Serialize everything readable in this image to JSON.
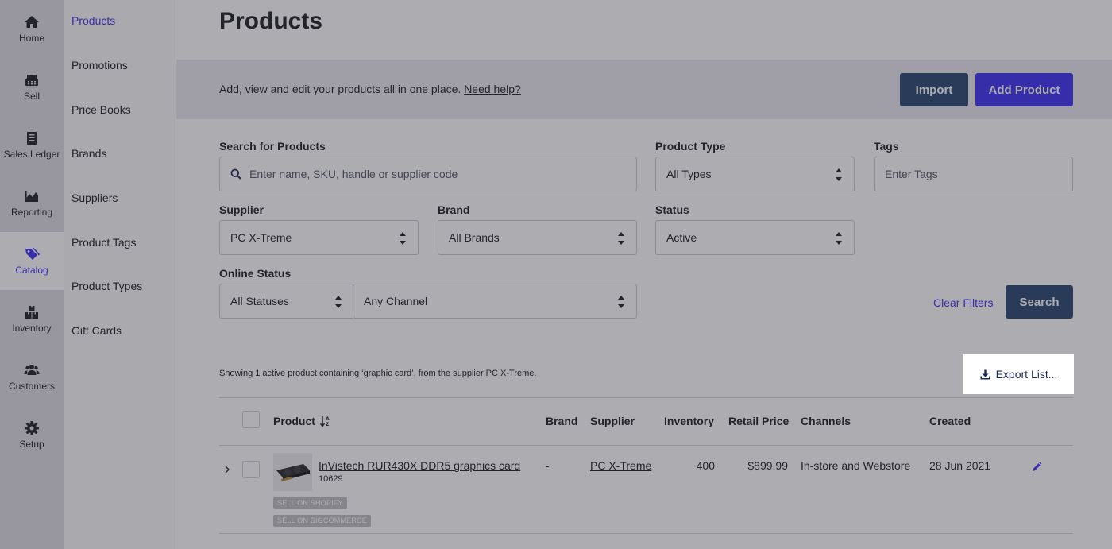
{
  "nav": {
    "items": [
      {
        "label": "Home",
        "icon": "home-icon"
      },
      {
        "label": "Sell",
        "icon": "register-icon"
      },
      {
        "label": "Sales Ledger",
        "icon": "ledger-icon"
      },
      {
        "label": "Reporting",
        "icon": "chart-icon"
      },
      {
        "label": "Catalog",
        "icon": "tags-icon"
      },
      {
        "label": "Inventory",
        "icon": "boxes-icon"
      },
      {
        "label": "Customers",
        "icon": "users-icon"
      },
      {
        "label": "Setup",
        "icon": "gear-icon"
      }
    ],
    "active": "Catalog"
  },
  "subnav": {
    "items": [
      "Products",
      "Promotions",
      "Price Books",
      "Brands",
      "Suppliers",
      "Product Tags",
      "Product Types",
      "Gift Cards"
    ],
    "active": "Products"
  },
  "page": {
    "title": "Products",
    "description": "Add, view and edit your products all in one place.",
    "help_link": "Need help?",
    "import_label": "Import",
    "add_label": "Add Product"
  },
  "filters": {
    "search_label": "Search for Products",
    "search_placeholder": "Enter name, SKU, handle or supplier code",
    "product_type_label": "Product Type",
    "product_type_value": "All Types",
    "tags_label": "Tags",
    "tags_placeholder": "Enter Tags",
    "supplier_label": "Supplier",
    "supplier_value": "PC X-Treme",
    "brand_label": "Brand",
    "brand_value": "All Brands",
    "status_label": "Status",
    "status_value": "Active",
    "online_status_label": "Online Status",
    "online_status_value": "All Statuses",
    "channel_value": "Any Channel",
    "clear_label": "Clear Filters",
    "search_button": "Search"
  },
  "results": {
    "summary": "Showing 1 active product containing ‘graphic card’, from the supplier PC X-Treme.",
    "export_label": "Export List...",
    "columns": {
      "product": "Product",
      "brand": "Brand",
      "supplier": "Supplier",
      "inventory": "Inventory",
      "retail_price": "Retail Price",
      "channels": "Channels",
      "created": "Created"
    },
    "rows": [
      {
        "name": "InVistech RUR430X DDR5 graphics card",
        "sku": "10629",
        "brand": "-",
        "supplier": "PC X-Treme",
        "inventory": "400",
        "retail_price": "$899.99",
        "channels": "In-store and Webstore",
        "created": "28 Jun 2021",
        "badges": [
          "SELL ON SHOPIFY",
          "SELL ON BIGCOMMERCE"
        ]
      }
    ]
  },
  "colors": {
    "accent": "#3f32f5",
    "navy": "#2b4a73"
  }
}
